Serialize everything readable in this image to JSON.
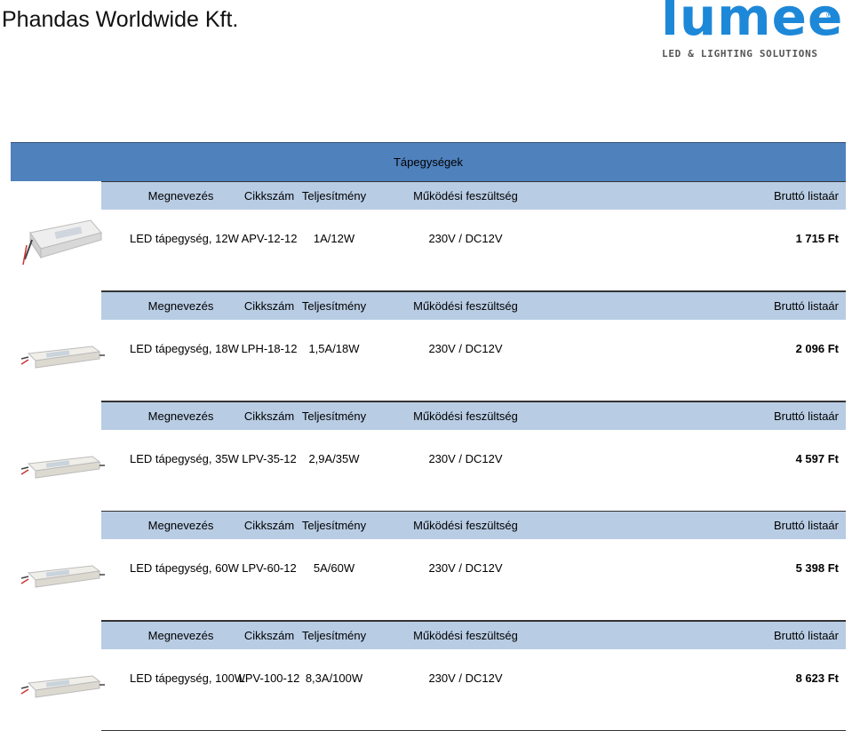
{
  "company_name": "Phandas Worldwide Kft.",
  "logo": {
    "word": "lumee",
    "reg": "®",
    "tagline": "LED & LIGHTING SOLUTIONS",
    "color": "#1e88d8"
  },
  "section_title": "Tápegységek",
  "columns": {
    "name": "Megnevezés",
    "code": "Cikkszám",
    "power": "Teljesítmény",
    "voltage": "Működési feszültség",
    "price": "Bruttó listaár"
  },
  "products": [
    {
      "name": "LED tápegység, 12W",
      "code": "APV-12-12",
      "power": "1A/12W",
      "voltage": "230V / DC12V",
      "price": "1 715 Ft",
      "image_icon": "power-supply-image"
    },
    {
      "name": "LED tápegység, 18W",
      "code": "LPH-18-12",
      "power": "1,5A/18W",
      "voltage": "230V / DC12V",
      "price": "2 096 Ft",
      "image_icon": "power-supply-image"
    },
    {
      "name": "LED tápegység, 35W",
      "code": "LPV-35-12",
      "power": "2,9A/35W",
      "voltage": "230V / DC12V",
      "price": "4 597 Ft",
      "image_icon": "power-supply-image"
    },
    {
      "name": "LED tápegység, 60W",
      "code": "LPV-60-12",
      "power": "5A/60W",
      "voltage": "230V / DC12V",
      "price": "5 398 Ft",
      "image_icon": "power-supply-image"
    },
    {
      "name": "LED tápegység, 100W",
      "code": "LPV-100-12",
      "power": "8,3A/100W",
      "voltage": "230V / DC12V",
      "price": "8 623 Ft",
      "image_icon": "power-supply-image"
    }
  ],
  "colors": {
    "title_bar": "#4f81bd",
    "header_row": "#b8cce4"
  }
}
